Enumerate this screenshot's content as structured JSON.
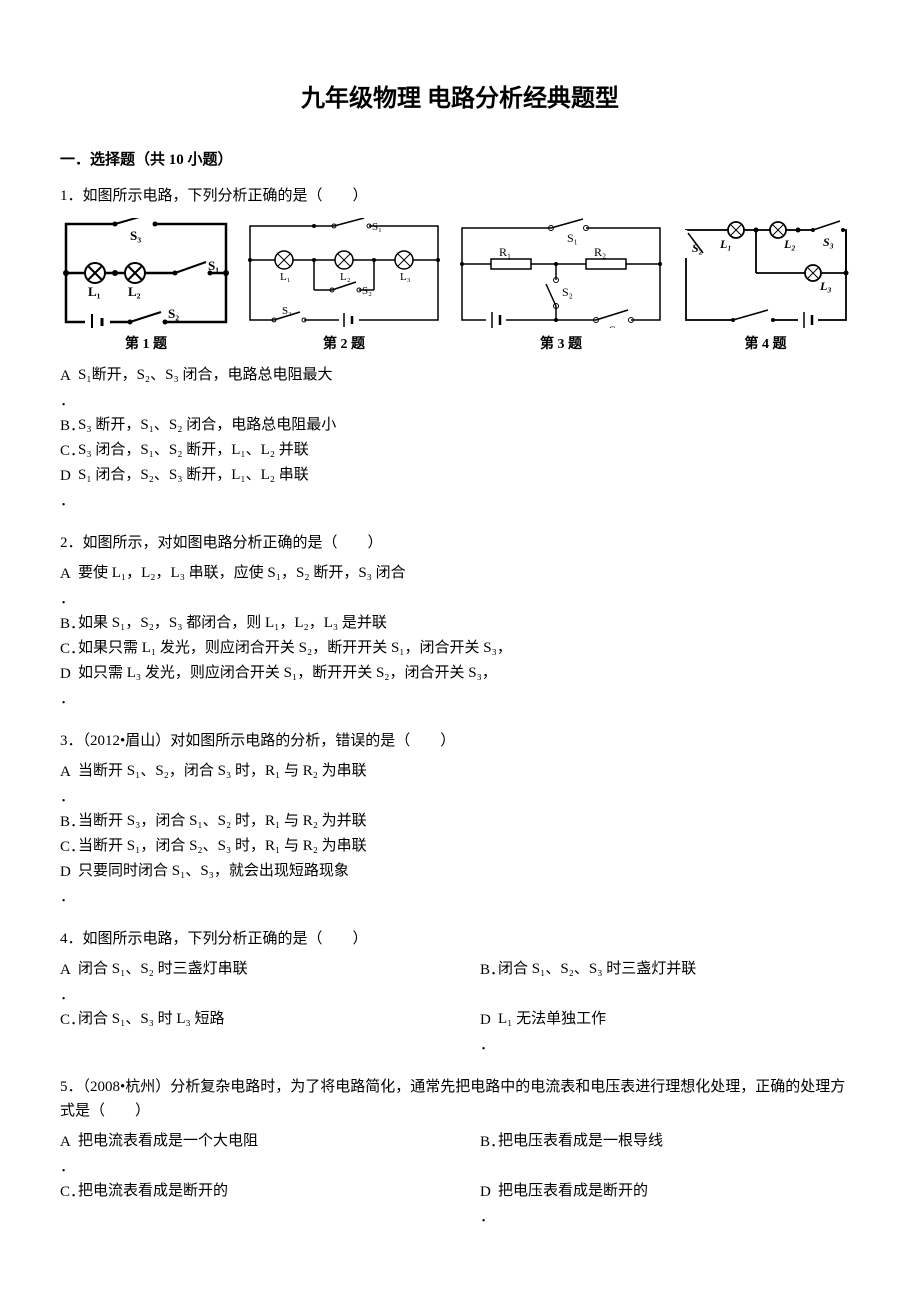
{
  "title": "九年级物理  电路分析经典题型",
  "section1": {
    "header": "一．选择题（共 10 小题）",
    "figureLabels": [
      "第 1 题",
      "第 2 题",
      "第 3 题",
      "第 4 题"
    ],
    "q1": {
      "stem": "1．如图所示电路，下列分析正确的是（　　）",
      "A": "S₁断开，S₂、S₃ 闭合，电路总电阻最大",
      "B": "S₃ 断开，S₁、S₂ 闭合，电路总电阻最小",
      "C": "S₃ 闭合，S₁、S₂ 断开，L₁、L₂ 并联",
      "D": "S₁ 闭合，S₂、S₃ 断开，L₁、L₂ 串联"
    },
    "q2": {
      "stem": "2．如图所示，对如图电路分析正确的是（　　）",
      "A": "要使 L₁，L₂，L₃ 串联，应使 S₁，S₂ 断开，S₃ 闭合",
      "B": "如果 S₁，S₂，S₃ 都闭合，则 L₁，L₂，L₃ 是并联",
      "C": "如果只需 L₁ 发光，则应闭合开关 S₂，断开开关 S₁，闭合开关 S₃，",
      "D": "如只需 L₃ 发光，则应闭合开关 S₁，断开开关 S₂，闭合开关 S₃，"
    },
    "q3": {
      "stem": "3．（2012•眉山）对如图所示电路的分析，错误的是（　　）",
      "A": "当断开 S₁、S₂，闭合 S₃ 时，R₁ 与 R₂ 为串联",
      "B": "当断开 S₃，闭合 S₁、S₂ 时，R₁ 与 R₂ 为并联",
      "C": "当断开 S₁，闭合 S₂、S₃ 时，R₁ 与 R₂ 为串联",
      "D": "只要同时闭合 S₁、S₃，就会出现短路现象"
    },
    "q4": {
      "stem": "4．如图所示电路，下列分析正确的是（　　）",
      "A": "闭合 S₁、S₂ 时三盏灯串联",
      "B": "闭合 S₁、S₂、S₃ 时三盏灯并联",
      "C": "闭合 S₁、S₃ 时 L₃ 短路",
      "D": "L₁ 无法单独工作"
    },
    "q5": {
      "stem": "5．（2008•杭州）分析复杂电路时，为了将电路简化，通常先把电路中的电流表和电压表进行理想化处理，正确的处理方式是（　　）",
      "A": "把电流表看成是一个大电阻",
      "B": "把电压表看成是一根导线",
      "C": "把电流表看成是断开的",
      "D": "把电压表看成是断开的"
    }
  }
}
